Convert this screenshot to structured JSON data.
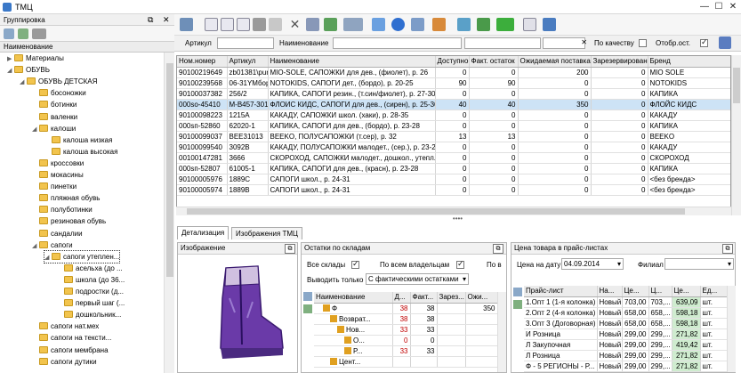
{
  "window": {
    "title": "ТМЦ",
    "min": "—",
    "max": "☐",
    "close": "✕"
  },
  "left": {
    "header": "Группировка",
    "dock": "⧉",
    "close": "✕",
    "col_header": "Наименование",
    "tree": [
      {
        "label": "Материалы",
        "indent": 0,
        "arrow": "▶"
      },
      {
        "label": "ОБУВЬ",
        "indent": 0,
        "arrow": "◢"
      },
      {
        "label": "ОБУВЬ ДЕТСКАЯ",
        "indent": 1,
        "arrow": "◢"
      },
      {
        "label": "босоножки",
        "indent": 2,
        "arrow": ""
      },
      {
        "label": "ботинки",
        "indent": 2,
        "arrow": ""
      },
      {
        "label": "валенки",
        "indent": 2,
        "arrow": ""
      },
      {
        "label": "калоши",
        "indent": 2,
        "arrow": "◢"
      },
      {
        "label": "калоша низкая",
        "indent": 3,
        "arrow": ""
      },
      {
        "label": "калоша высокая",
        "indent": 3,
        "arrow": ""
      },
      {
        "label": "кроссовки",
        "indent": 2,
        "arrow": ""
      },
      {
        "label": "мокасины",
        "indent": 2,
        "arrow": ""
      },
      {
        "label": "пинетки",
        "indent": 2,
        "arrow": ""
      },
      {
        "label": "пляжная обувь",
        "indent": 2,
        "arrow": ""
      },
      {
        "label": "полуботинки",
        "indent": 2,
        "arrow": ""
      },
      {
        "label": "резиновая обувь",
        "indent": 2,
        "arrow": ""
      },
      {
        "label": "сандалии",
        "indent": 2,
        "arrow": ""
      },
      {
        "label": "сапоги",
        "indent": 2,
        "arrow": "◢"
      },
      {
        "label": "сапоги утеплен...",
        "indent": 3,
        "arrow": "◢",
        "selected": true
      },
      {
        "label": "асельха (до ...",
        "indent": 4,
        "arrow": ""
      },
      {
        "label": "школа (до 36...",
        "indent": 4,
        "arrow": ""
      },
      {
        "label": "подростки (д...",
        "indent": 4,
        "arrow": ""
      },
      {
        "label": "первый шаг (...",
        "indent": 4,
        "arrow": ""
      },
      {
        "label": "дошкольник...",
        "indent": 4,
        "arrow": ""
      },
      {
        "label": "сапоги нат.мех",
        "indent": 2,
        "arrow": ""
      },
      {
        "label": "сапоги на тексти...",
        "indent": 2,
        "arrow": ""
      },
      {
        "label": "сапоги мембрана",
        "indent": 2,
        "arrow": ""
      },
      {
        "label": "сапоги дутики",
        "indent": 2,
        "arrow": ""
      }
    ]
  },
  "filter": {
    "article_label": "Артикул",
    "name_label": "Наименование",
    "quality_label": "По качеству",
    "show_rest_label": "Отобр.ост.",
    "clear": "✕"
  },
  "grid": {
    "columns": [
      "Ном.номер",
      "Артикул",
      "Наименование",
      "Доступно",
      "Факт. остаток",
      "Ожидаемая поставка",
      "Зарезервировано",
      "Бренд"
    ],
    "rows": [
      [
        "90100219649",
        "zb01381\\purple",
        "MIO-SOLE, САПОЖКИ для дев., (фиолет), р. 26",
        "0",
        "0",
        "200",
        "0",
        "MIO SOLE"
      ],
      [
        "90100239568",
        "06-31YMбордо",
        "NOTOKIDS, САПОГИ дет., (бордо), р. 20-25",
        "90",
        "90",
        "0",
        "0",
        "NOTOKIDS"
      ],
      [
        "90100037382",
        "256/2",
        "КАПИКА, САПОГИ резин., (т.син/фиолет), р. 27-30",
        "0",
        "0",
        "0",
        "0",
        "КАПИКА"
      ],
      [
        "000sо-45410",
        "M-B457-301сир",
        "ФЛОИС КИДС, САПОГИ для дев., (сирен), р. 25-30",
        "40",
        "40",
        "350",
        "0",
        "ФЛОЙС КИДС"
      ],
      [
        "90100098223",
        "1215А",
        "КАКАДУ, САПОЖКИ школ. (хаки), р. 28-35",
        "0",
        "0",
        "0",
        "0",
        "КАКАДУ"
      ],
      [
        "000sп-52860",
        "62020-1",
        "КАПИКА, САПОГИ для дев., (бордо), р. 23-28",
        "0",
        "0",
        "0",
        "0",
        "КАПИКА"
      ],
      [
        "90100099037",
        "BEE31013",
        "BEEKO, ПОЛУСАПОЖКИ (т.сер), р. 32",
        "13",
        "13",
        "0",
        "0",
        "BEEKO"
      ],
      [
        "90100099540",
        "3092В",
        "КАКАДУ, ПОЛУСАПОЖКИ малодет., (сер.), р. 23-28",
        "0",
        "0",
        "0",
        "0",
        "КАКАДУ"
      ],
      [
        "00100147281",
        "3666",
        "СКОРОХОД, САПОЖКИ малодет., дошкол., утепл., (н/...",
        "0",
        "0",
        "0",
        "0",
        "СКОРОХОД"
      ],
      [
        "000sп-52807",
        "61005-1",
        "КАПИКА, САПОГИ для дев., (красн), р. 23-28",
        "0",
        "0",
        "0",
        "0",
        "КАПИКА"
      ],
      [
        "90100005976",
        "1889С",
        "САПОГИ школ., р. 24-31",
        "0",
        "0",
        "0",
        "0",
        "<без бренда>"
      ],
      [
        "90100005974",
        "1889В",
        "САПОГИ школ., р. 24-31",
        "0",
        "0",
        "0",
        "0",
        "<без бренда>"
      ]
    ],
    "selected_row": 3
  },
  "tabs": [
    "Детализация",
    "Изображения ТМЦ"
  ],
  "image_pane": {
    "header": "Изображение"
  },
  "stock_pane": {
    "header": "Остатки по складам",
    "all_wh": "Все склады",
    "all_owners": "По всем владельцам",
    "po": "По в",
    "only_label": "Выводить только",
    "only_value": "С фактическими остатками",
    "columns": [
      "Наименование",
      "Д...",
      "Факт...",
      "Зарез...",
      "Ожи..."
    ],
    "rows": [
      {
        "name": "Ф",
        "d": "38",
        "f": "38",
        "z": "",
        "o": "350",
        "indent": 1
      },
      {
        "name": "Возврат...",
        "d": "38",
        "f": "38",
        "z": "",
        "o": "",
        "indent": 2
      },
      {
        "name": "Нов...",
        "d": "33",
        "f": "33",
        "z": "",
        "o": "",
        "indent": 3
      },
      {
        "name": "О...",
        "d": "0",
        "f": "0",
        "z": "",
        "o": "",
        "indent": 4
      },
      {
        "name": "Р...",
        "d": "33",
        "f": "33",
        "z": "",
        "o": "",
        "indent": 4
      },
      {
        "name": "Цент...",
        "d": "",
        "f": "",
        "z": "",
        "o": "",
        "indent": 2
      }
    ]
  },
  "price_pane": {
    "header": "Цена товара в прайс-листах",
    "date_label": "Цена на дату",
    "date_value": "04.09.2014",
    "branch_label": "Филиал",
    "columns": [
      "Прайс-лист",
      "На...",
      "Це...",
      "Ц...",
      "Це...",
      "Ед..."
    ],
    "rows": [
      [
        "1.Опт 1 (1-я колонка)",
        "Новый",
        "703,00",
        "703,...",
        "639,09",
        "шт."
      ],
      [
        "2.Опт 2 (4-я колонка)",
        "Новый",
        "658,00",
        "658,...",
        "598,18",
        "шт."
      ],
      [
        "3.Опт 3 (Договорная)",
        "Новый",
        "658,00",
        "658,...",
        "598,18",
        "шт."
      ],
      [
        "И   Розница",
        "Новый",
        "299,00",
        "299,...",
        "271,82",
        "шт."
      ],
      [
        "Л   Закупочная",
        "Новый",
        "299,00",
        "299,...",
        "419,42",
        "шт."
      ],
      [
        "Л   Розница",
        "Новый",
        "299,00",
        "299,...",
        "271,82",
        "шт."
      ],
      [
        "Ф - 5 РЕГИОНЫ - Р...",
        "Новый",
        "299,00",
        "299,...",
        "271,82",
        "шт."
      ]
    ]
  }
}
